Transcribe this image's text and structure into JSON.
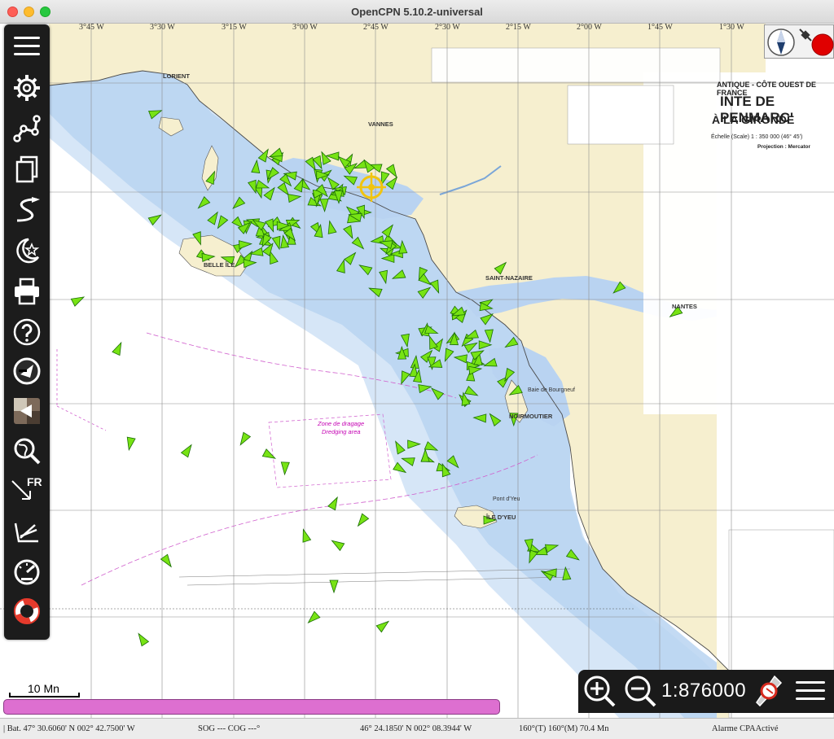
{
  "window": {
    "title": "OpenCPN 5.10.2-universal"
  },
  "colors": {
    "land": "#f6efcf",
    "shallow": "#b9d3f1",
    "mid_water": "#d6e6f7",
    "deep_water": "#ffffff",
    "ais_target": "#77e314",
    "ais_outline": "#1b6d06",
    "own_ship": "#f1c40f",
    "tide_bar": "#dd6fd0"
  },
  "toolbar": {
    "items": [
      {
        "id": "menu",
        "icon": "hamburger-icon"
      },
      {
        "id": "settings",
        "icon": "gear-icon"
      },
      {
        "id": "route",
        "icon": "route-icon"
      },
      {
        "id": "route-manager",
        "icon": "documents-icon"
      },
      {
        "id": "track",
        "icon": "track-icon"
      },
      {
        "id": "tides",
        "icon": "moon-star-icon"
      },
      {
        "id": "print",
        "icon": "printer-icon"
      },
      {
        "id": "help",
        "icon": "help-icon"
      },
      {
        "id": "ais",
        "icon": "ais-icon"
      },
      {
        "id": "layers",
        "icon": "layers-icon"
      },
      {
        "id": "find",
        "icon": "globe-search-icon"
      },
      {
        "id": "language",
        "icon": "arrow-fr-icon",
        "label": "FR"
      },
      {
        "id": "anchor",
        "icon": "anchor-lines-icon"
      },
      {
        "id": "dashboard",
        "icon": "gauge-icon"
      },
      {
        "id": "mob",
        "icon": "lifebuoy-icon"
      }
    ]
  },
  "grid": {
    "longitudes": [
      "3°45 W",
      "3°30 W",
      "3°15 W",
      "3°00 W",
      "2°45 W",
      "2°30 W",
      "2°15 W",
      "2°00 W",
      "1°45 W",
      "1°30 W"
    ]
  },
  "legend": {
    "title_1": "ANTIQUE - CÔTE OUEST DE FRANCE",
    "title_2": "INTE DE PENMARC'",
    "title_3": "À LA GIRONDE",
    "scale": "Échelle (Scale) 1 : 350 000 (46° 45')",
    "projection": "Projection : Mercator"
  },
  "places": {
    "lorient": "LORIENT",
    "vannes": "VANNES",
    "st_nazaire": "SAINT-NAZAIRE",
    "nantes": "NANTES",
    "ile_yeu": "ÎLE D'YEU",
    "belle_ile": "BELLE ÎLE",
    "noirmoutier": "NOIRMOUTIER",
    "pont_yeu": "Pont d'Yeu",
    "baie_bourgneuf": "Baie de Bourgneuf",
    "dragage": "Zone de dragage",
    "dredging": "Dredging area"
  },
  "zoom": {
    "scale_label": "1:876000"
  },
  "scale_bar": {
    "label": "10 Mn"
  },
  "status": {
    "boat_position": "| Bat. 47° 30.6060' N   002° 42.7500' W",
    "sog_cog": "SOG --- COG ---°",
    "cursor_position": "46° 24.1850' N   002° 08.3944' W",
    "bearing_distance": "160°(T)  160°(M)  70.4 Mn",
    "alarm": "Alarme CPAActivé"
  }
}
